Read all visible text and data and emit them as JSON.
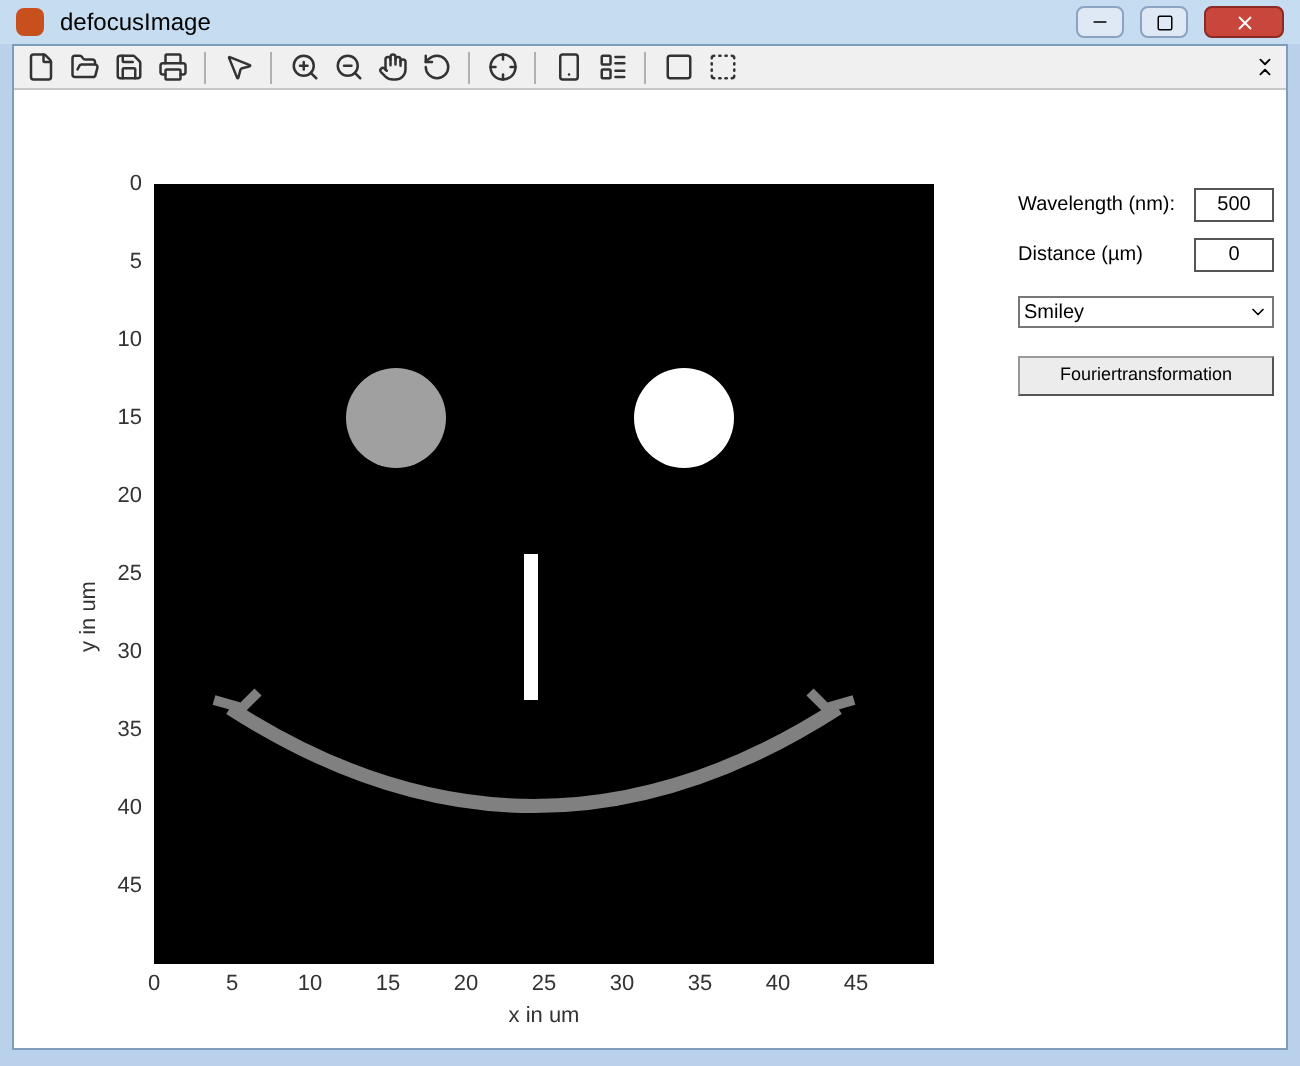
{
  "window": {
    "title": "defocusImage"
  },
  "plot": {
    "ylabel": "y in um",
    "xlabel": "x in um",
    "yticks": [
      "0",
      "5",
      "10",
      "15",
      "20",
      "25",
      "30",
      "35",
      "40",
      "45"
    ],
    "xticks": [
      "0",
      "5",
      "10",
      "15",
      "20",
      "25",
      "30",
      "35",
      "40",
      "45"
    ]
  },
  "controls": {
    "wavelength": {
      "label": "Wavelength (nm):",
      "value": "500"
    },
    "distance": {
      "label": "Distance (µm)",
      "value": "0"
    },
    "pattern": {
      "value": "Smiley"
    },
    "button": {
      "label": "Fouriertransformation"
    }
  }
}
